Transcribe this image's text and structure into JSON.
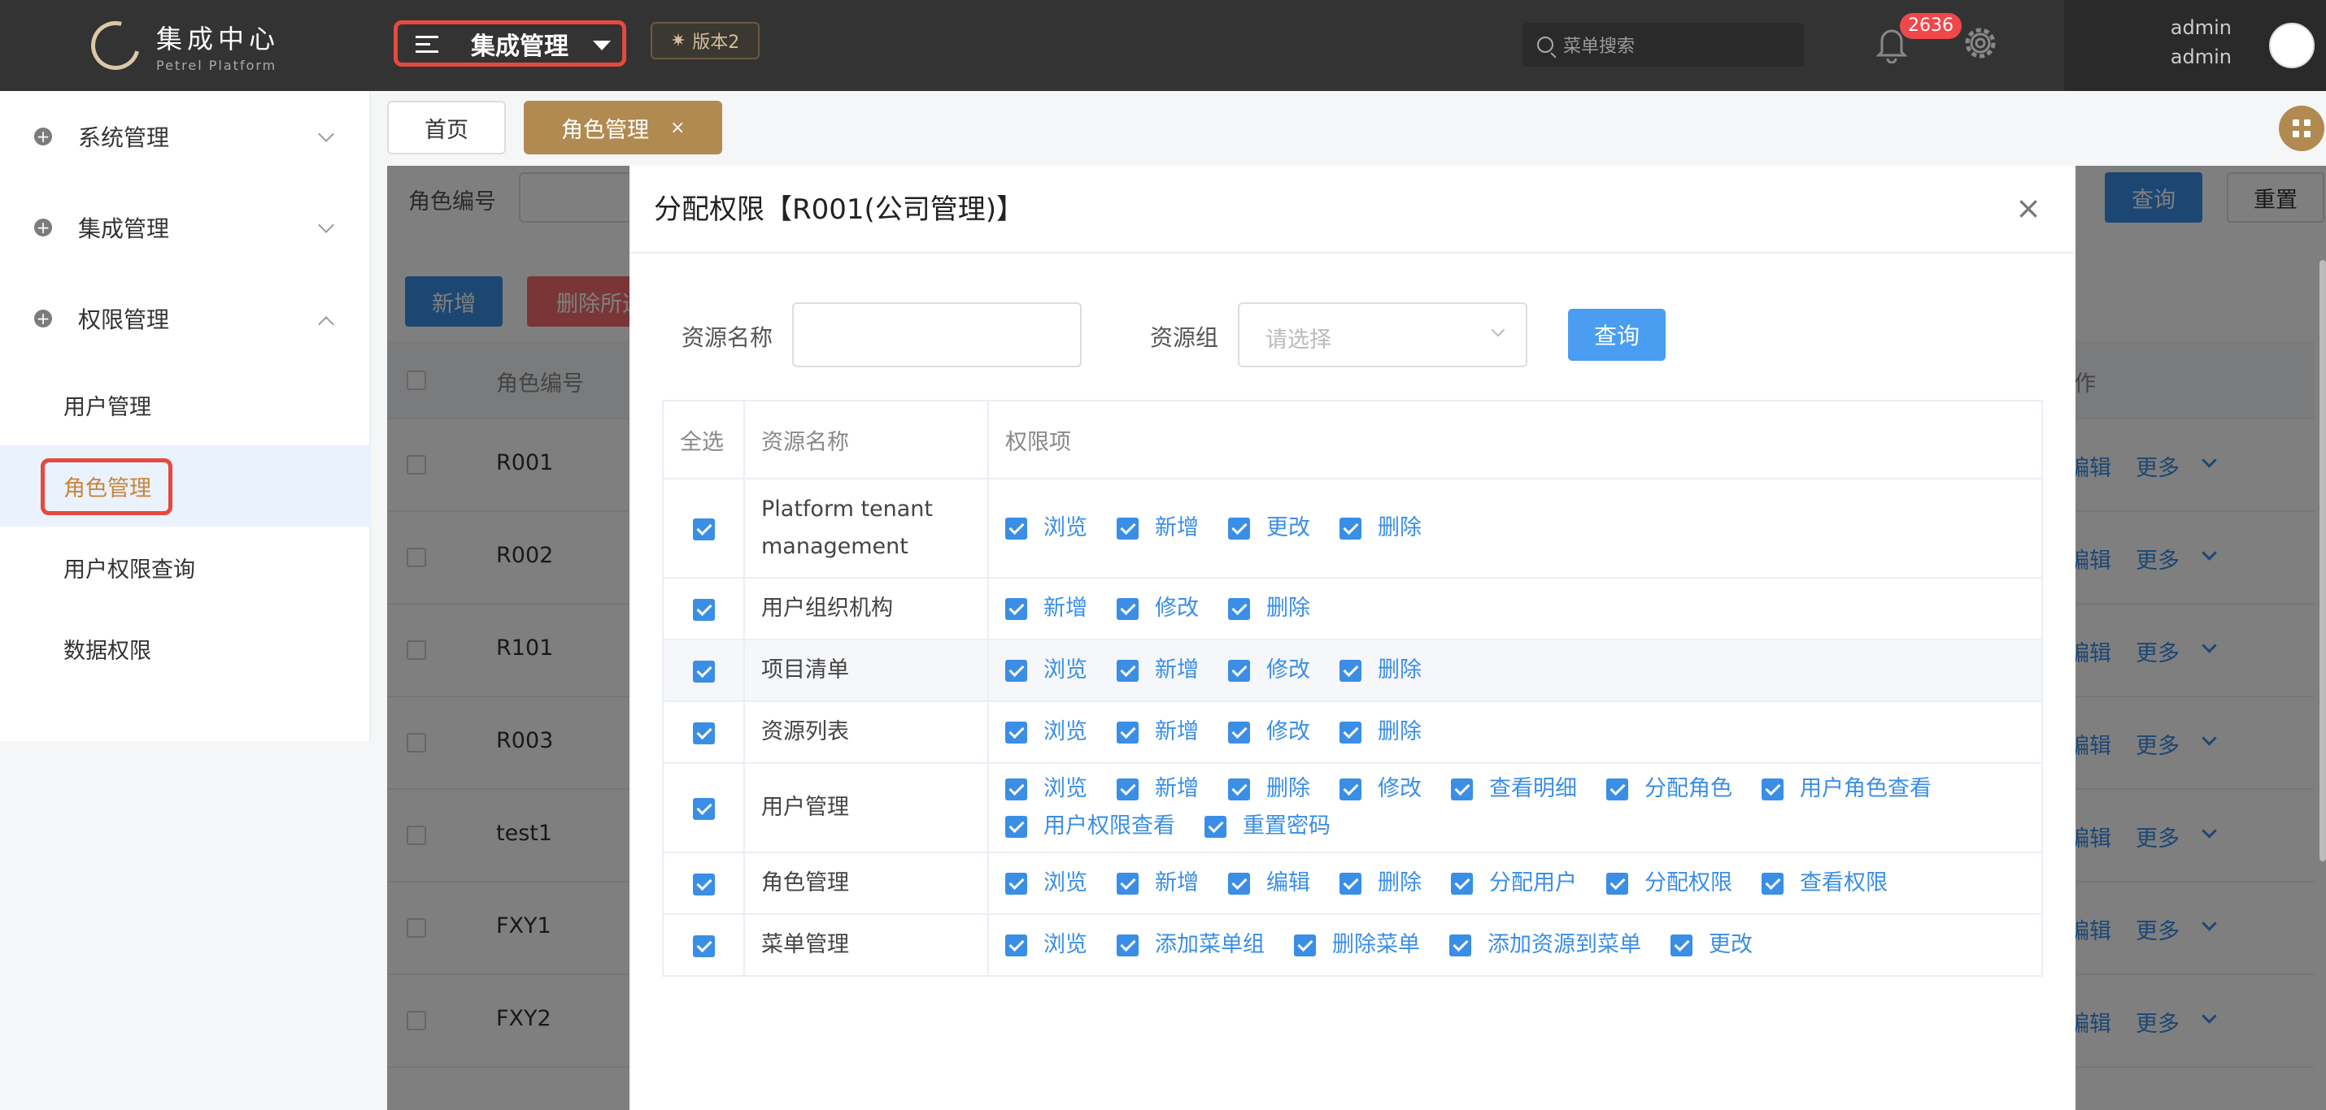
{
  "brand": {
    "t": "集成中心",
    "s": "Petrel Platform"
  },
  "sys": "集成管理",
  "ver": "版本2",
  "srch": "菜单搜索",
  "notif": "2636",
  "user": {
    "a": "admin",
    "b": "admin"
  },
  "side": {
    "a": "系统管理",
    "b": "集成管理",
    "c": "权限管理",
    "s": [
      "用户管理",
      "角色管理",
      "用户权限查询",
      "数据权限"
    ]
  },
  "tabs": {
    "home": "首页",
    "role": "角色管理",
    "x": "×"
  },
  "bg": {
    "lbl": "角色编号",
    "q": "查询",
    "reset": "重置",
    "add": "新增",
    "del": "删除所选",
    "th": "角色编号",
    "op": "作",
    "codes": [
      "R001",
      "R002",
      "R101",
      "R003",
      "test1",
      "FXY1",
      "FXY2"
    ],
    "edit": "编辑",
    "more": "更多"
  },
  "modal": {
    "title": "分配权限【R001(公司管理)】",
    "close": "×",
    "l1": "资源名称",
    "l2": "资源组",
    "ph": "请选择",
    "q": "查询",
    "h": [
      "全选",
      "资源名称",
      "权限项"
    ],
    "rows": [
      {
        "n": "Platform tenant management",
        "p": [
          "浏览",
          "新增",
          "更改",
          "删除"
        ]
      },
      {
        "n": "用户组织机构",
        "p": [
          "新增",
          "修改",
          "删除"
        ]
      },
      {
        "n": "项目清单",
        "p": [
          "浏览",
          "新增",
          "修改",
          "删除"
        ]
      },
      {
        "n": "资源列表",
        "p": [
          "浏览",
          "新增",
          "修改",
          "删除"
        ]
      },
      {
        "n": "用户管理",
        "p": [
          "浏览",
          "新增",
          "删除",
          "修改",
          "查看明细",
          "分配角色",
          "用户角色查看",
          "用户权限查看",
          "重置密码"
        ]
      },
      {
        "n": "角色管理",
        "p": [
          "浏览",
          "新增",
          "编辑",
          "删除",
          "分配用户",
          "分配权限",
          "查看权限"
        ]
      },
      {
        "n": "菜单管理",
        "p": [
          "浏览",
          "添加菜单组",
          "删除菜单",
          "添加资源到菜单",
          "更改"
        ]
      }
    ]
  }
}
